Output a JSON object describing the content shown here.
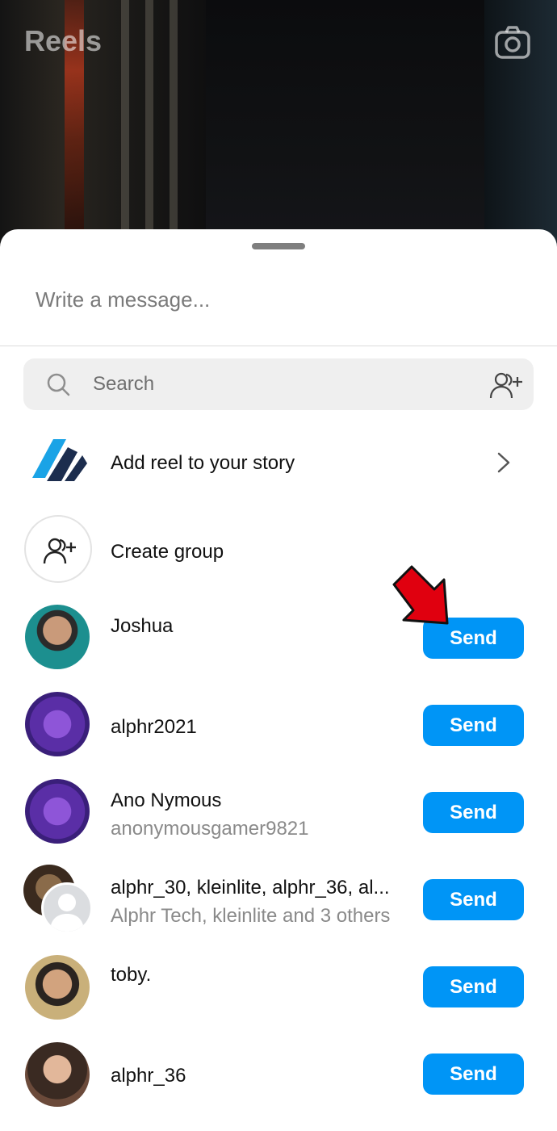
{
  "header": {
    "title": "Reels",
    "camera_icon": "camera-icon"
  },
  "sheet": {
    "message_placeholder": "Write a message...",
    "search_placeholder": "Search",
    "add_story": {
      "label": "Add reel to your story"
    },
    "create_group": {
      "label": "Create group"
    },
    "contacts": [
      {
        "name": "Joshua",
        "subtitle": "",
        "button": "Send"
      },
      {
        "name": "alphr2021",
        "subtitle": "",
        "button": "Send"
      },
      {
        "name": "Ano Nymous",
        "subtitle": "anonymousgamer9821",
        "button": "Send"
      },
      {
        "name": "alphr_30, kleinlite, alphr_36, al...",
        "subtitle": "Alphr Tech, kleinlite and 3 others",
        "button": "Send"
      },
      {
        "name": "toby.",
        "subtitle": "",
        "button": "Send"
      },
      {
        "name": "alphr_36",
        "subtitle": "",
        "button": "Send"
      }
    ]
  },
  "colors": {
    "accent": "#0095f6",
    "annotation_arrow": "#e0000f"
  }
}
